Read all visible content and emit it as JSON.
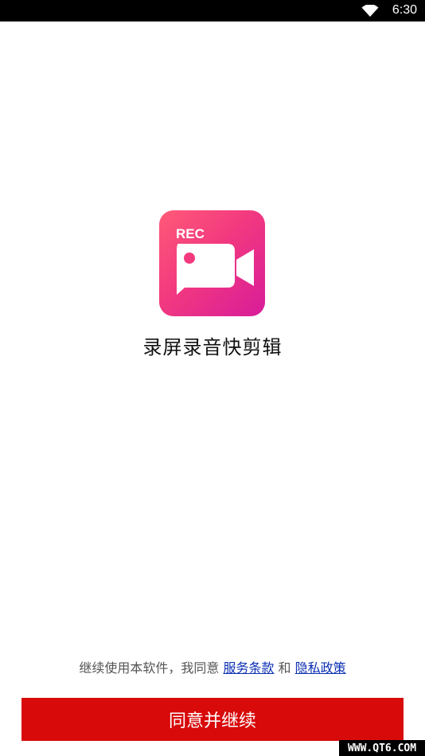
{
  "status_bar": {
    "time": "6:30",
    "wifi_icon": "wifi-icon"
  },
  "app": {
    "icon": {
      "name": "video-camera-rec-icon",
      "rec_text": "REC",
      "gradient": [
        "#ff5a78",
        "#f2397f",
        "#d81c9a"
      ]
    },
    "name": "录屏录音快剪辑"
  },
  "agreement": {
    "prefix": "继续使用本软件，我同意",
    "terms_link": "服务条款",
    "conjunction": "和",
    "privacy_link": "隐私政策",
    "link_color": "#0b2fb3"
  },
  "actions": {
    "agree_button": "同意并继续",
    "button_color": "#d80a0a"
  },
  "watermark": "WWW.QT6.COM"
}
